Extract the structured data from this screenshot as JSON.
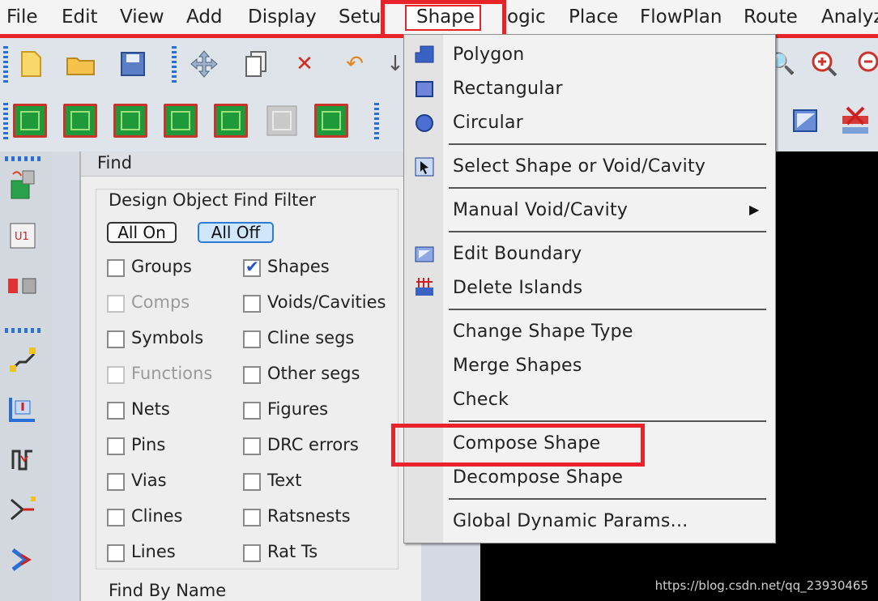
{
  "menubar": {
    "items": [
      "File",
      "Edit",
      "View",
      "Add",
      "Display",
      "Setu",
      "Shape",
      "ogic",
      "Place",
      "FlowPlan",
      "Route",
      "Analyz"
    ]
  },
  "find_panel": {
    "title": "Find",
    "filter_title": "Design Object Find Filter",
    "all_on": "All On",
    "all_off": "All Off",
    "left_items": [
      {
        "label": "Groups",
        "checked": false,
        "enabled": true
      },
      {
        "label": "Comps",
        "checked": false,
        "enabled": false
      },
      {
        "label": "Symbols",
        "checked": false,
        "enabled": true
      },
      {
        "label": "Functions",
        "checked": false,
        "enabled": false
      },
      {
        "label": "Nets",
        "checked": false,
        "enabled": true
      },
      {
        "label": "Pins",
        "checked": false,
        "enabled": true
      },
      {
        "label": "Vias",
        "checked": false,
        "enabled": true
      },
      {
        "label": "Clines",
        "checked": false,
        "enabled": true
      },
      {
        "label": "Lines",
        "checked": false,
        "enabled": true
      }
    ],
    "right_items": [
      {
        "label": "Shapes",
        "checked": true,
        "enabled": true
      },
      {
        "label": "Voids/Cavities",
        "checked": false,
        "enabled": true
      },
      {
        "label": "Cline segs",
        "checked": false,
        "enabled": true
      },
      {
        "label": "Other segs",
        "checked": false,
        "enabled": true
      },
      {
        "label": "Figures",
        "checked": false,
        "enabled": true
      },
      {
        "label": "DRC errors",
        "checked": false,
        "enabled": true
      },
      {
        "label": "Text",
        "checked": false,
        "enabled": true
      },
      {
        "label": "Ratsnests",
        "checked": false,
        "enabled": true
      },
      {
        "label": "Rat Ts",
        "checked": false,
        "enabled": true
      }
    ],
    "find_by_name": "Find By Name"
  },
  "shape_menu": {
    "items": [
      "Polygon",
      "Rectangular",
      "Circular",
      "Select Shape or Void/Cavity",
      "Manual Void/Cavity",
      "Edit Boundary",
      "Delete Islands",
      "Change Shape Type",
      "Merge Shapes",
      "Check",
      "Compose Shape",
      "Decompose Shape",
      "Global Dynamic Params..."
    ]
  },
  "watermark": "https://blog.csdn.net/qq_23930465",
  "colors": {
    "highlight": "#e8232a",
    "accent": "#2c7bd6",
    "canvas": "#000000"
  }
}
